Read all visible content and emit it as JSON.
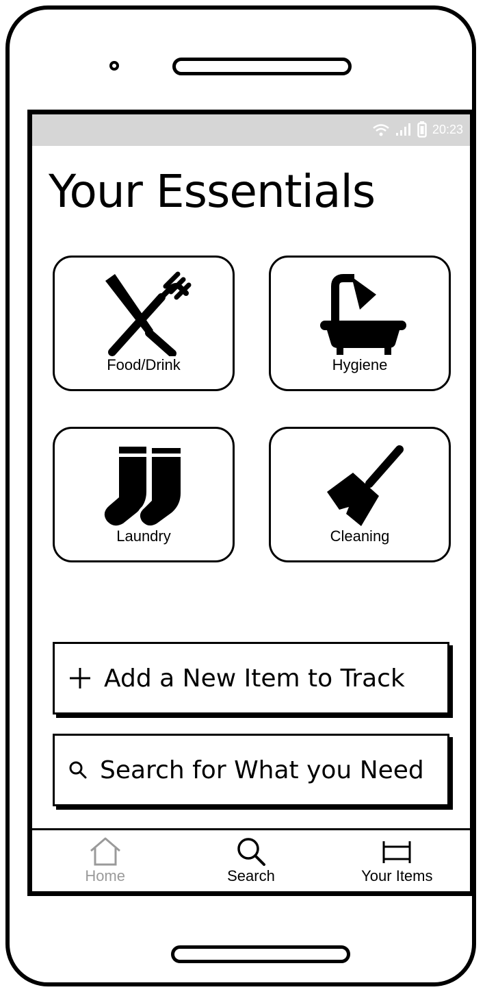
{
  "status_bar": {
    "time": "20:23",
    "icons": [
      "wifi-icon",
      "signal-icon",
      "battery-icon"
    ]
  },
  "page_title": "Your Essentials",
  "categories": [
    {
      "label": "Food/Drink",
      "icon": "fork-knife-icon"
    },
    {
      "label": "Hygiene",
      "icon": "bathtub-shower-icon"
    },
    {
      "label": "Laundry",
      "icon": "socks-icon"
    },
    {
      "label": "Cleaning",
      "icon": "broom-icon"
    }
  ],
  "actions": {
    "add_label": "Add a New Item to Track",
    "add_icon": "plus-icon",
    "search_label": "Search for What you Need",
    "search_icon": "search-icon"
  },
  "tabs": [
    {
      "label": "Home",
      "icon": "home-icon",
      "active": false
    },
    {
      "label": "Search",
      "icon": "search-icon",
      "active": true
    },
    {
      "label": "Your Items",
      "icon": "bed-icon",
      "active": true
    }
  ],
  "colors": {
    "status_bar_bg": "#d6d6d6",
    "inactive_tab": "#9a9a9a",
    "ink": "#000000"
  }
}
